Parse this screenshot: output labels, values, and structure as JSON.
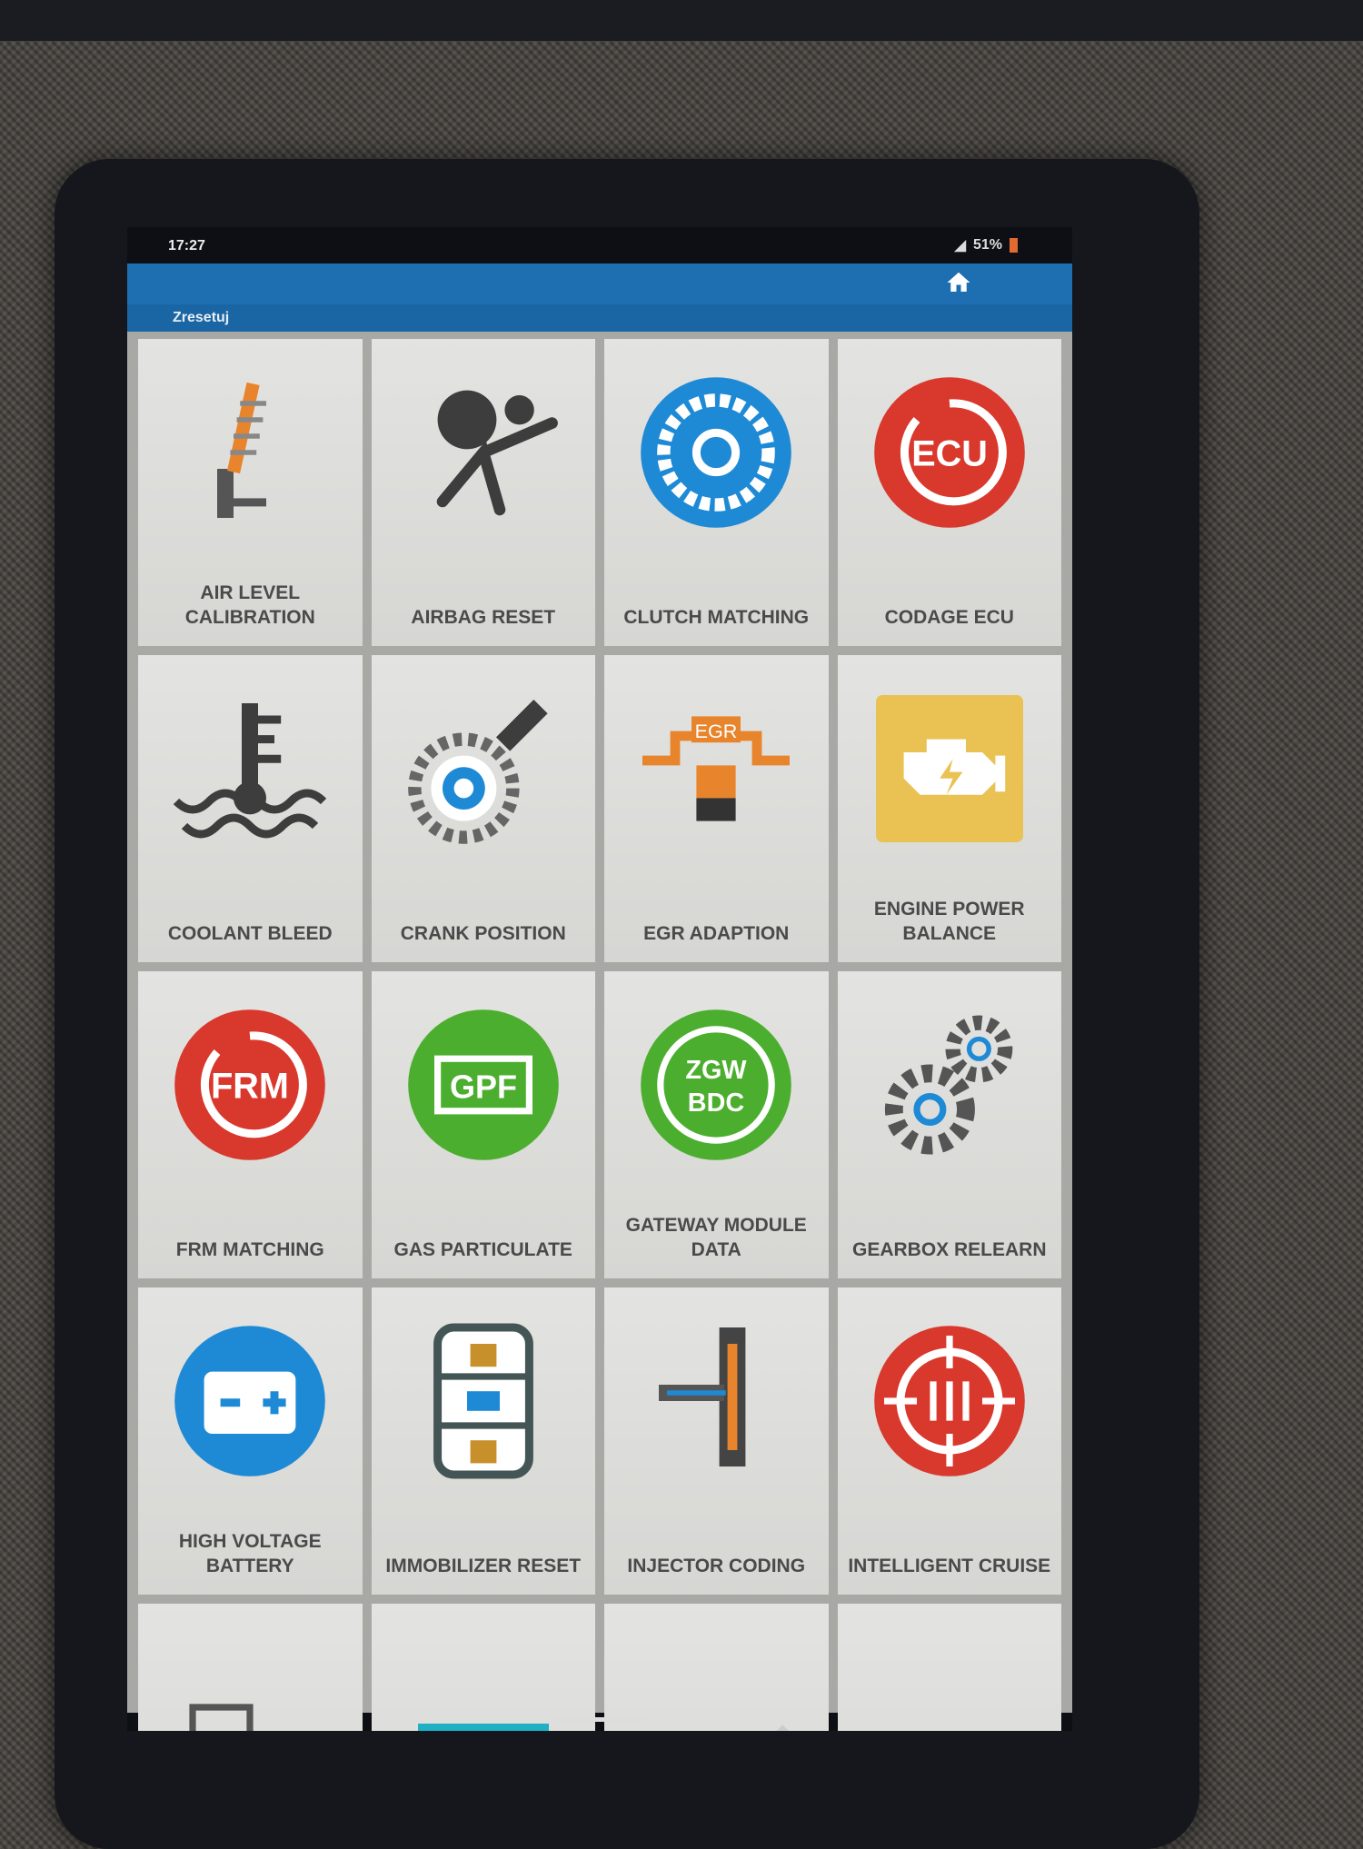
{
  "status_bar": {
    "time": "17:27",
    "battery": "51%"
  },
  "header": {
    "title": "Zresetuj",
    "home_icon": "home-icon"
  },
  "colors": {
    "header": "#1d6fb2",
    "red": "#d9382c",
    "blue": "#1e8ad6",
    "green": "#4cae2e",
    "yellow": "#e9c253",
    "orange": "#e8842c"
  },
  "tiles": [
    {
      "label": "Air Level Calibration",
      "icon": "air-suspension-icon"
    },
    {
      "label": "Airbag Reset",
      "icon": "airbag-icon"
    },
    {
      "label": "Clutch Matching",
      "icon": "clutch-icon"
    },
    {
      "label": "Codage ECU",
      "icon": "ecu-icon",
      "icon_text": "ECU"
    },
    {
      "label": "Coolant Bleed",
      "icon": "coolant-icon"
    },
    {
      "label": "Crank Position",
      "icon": "crank-sensor-icon"
    },
    {
      "label": "EGR Adaption",
      "icon": "egr-icon",
      "icon_text": "EGR"
    },
    {
      "label": "Engine Power Balance",
      "icon": "engine-icon"
    },
    {
      "label": "FRM Matching",
      "icon": "frm-icon",
      "icon_text": "FRM"
    },
    {
      "label": "Gas Particulate",
      "icon": "gpf-icon",
      "icon_text": "GPF"
    },
    {
      "label": "Gateway Module Data",
      "icon": "gateway-icon",
      "icon_text": "ZGW",
      "icon_text2": "BDC"
    },
    {
      "label": "Gearbox Relearn",
      "icon": "gears-icon"
    },
    {
      "label": "High Voltage Battery",
      "icon": "battery-icon"
    },
    {
      "label": "Immobilizer Reset",
      "icon": "immobilizer-icon"
    },
    {
      "label": "Injector Coding",
      "icon": "injector-icon"
    },
    {
      "label": "Intelligent Cruise",
      "icon": "cruise-icon"
    },
    {
      "label": "",
      "icon": "language-icon"
    },
    {
      "label": "",
      "icon": "seat-icon"
    },
    {
      "label": "",
      "icon": "spark-plug-icon"
    },
    {
      "label": "",
      "icon": ""
    }
  ]
}
